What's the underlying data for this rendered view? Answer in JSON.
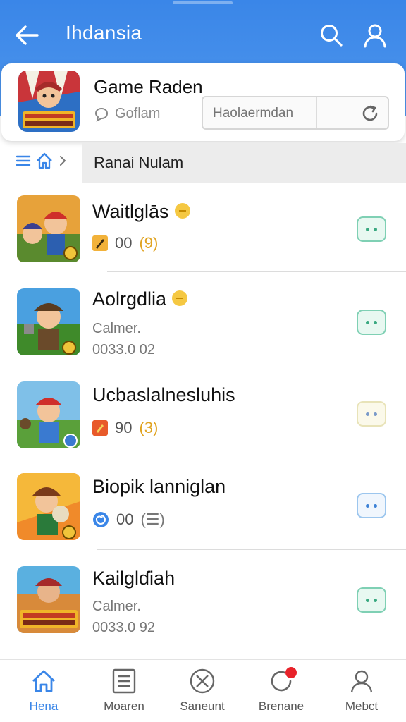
{
  "header": {
    "title": "Ihdansia"
  },
  "game_card": {
    "title": "Game Raden",
    "subtitle": "Goflam",
    "search_placeholder": "Haolaermdan"
  },
  "breadcrumb": {
    "label": "Ranai Nulam"
  },
  "items": [
    {
      "name": "Waitlglās",
      "meta_count": "00",
      "meta_badge": "(9)",
      "icon": "rocket-icon",
      "chat_style": "green"
    },
    {
      "name": "Aolrgdlia",
      "line1": "Calmer.",
      "line2": "0033.0 02",
      "chat_style": "green"
    },
    {
      "name": "Ucbaslalnesluhis",
      "meta_count": "90",
      "meta_badge": "(3)",
      "icon": "rocket-icon",
      "chat_style": "yellow"
    },
    {
      "name": "Biopik lanniglan",
      "meta_count": "00",
      "meta_badge": "(☰)",
      "icon": "spiral-icon",
      "chat_style": "blue"
    },
    {
      "name": "Kailglɗiah",
      "line1": "Calmer.",
      "line2": "0033.0 92",
      "chat_style": "green"
    }
  ],
  "bottom_nav": [
    {
      "label": "Hena",
      "icon": "home-icon",
      "active": true
    },
    {
      "label": "Moaren",
      "icon": "list-icon",
      "active": false
    },
    {
      "label": "Saneunt",
      "icon": "compass-icon",
      "active": false
    },
    {
      "label": "Brenane",
      "icon": "notification-icon",
      "active": false
    },
    {
      "label": "Mebct",
      "icon": "profile-icon",
      "active": false
    }
  ],
  "colors": {
    "primary": "#3a86e8",
    "chat_green": "#7fd0b4",
    "coin": "#f5c842",
    "badge_red": "#e8222a"
  }
}
